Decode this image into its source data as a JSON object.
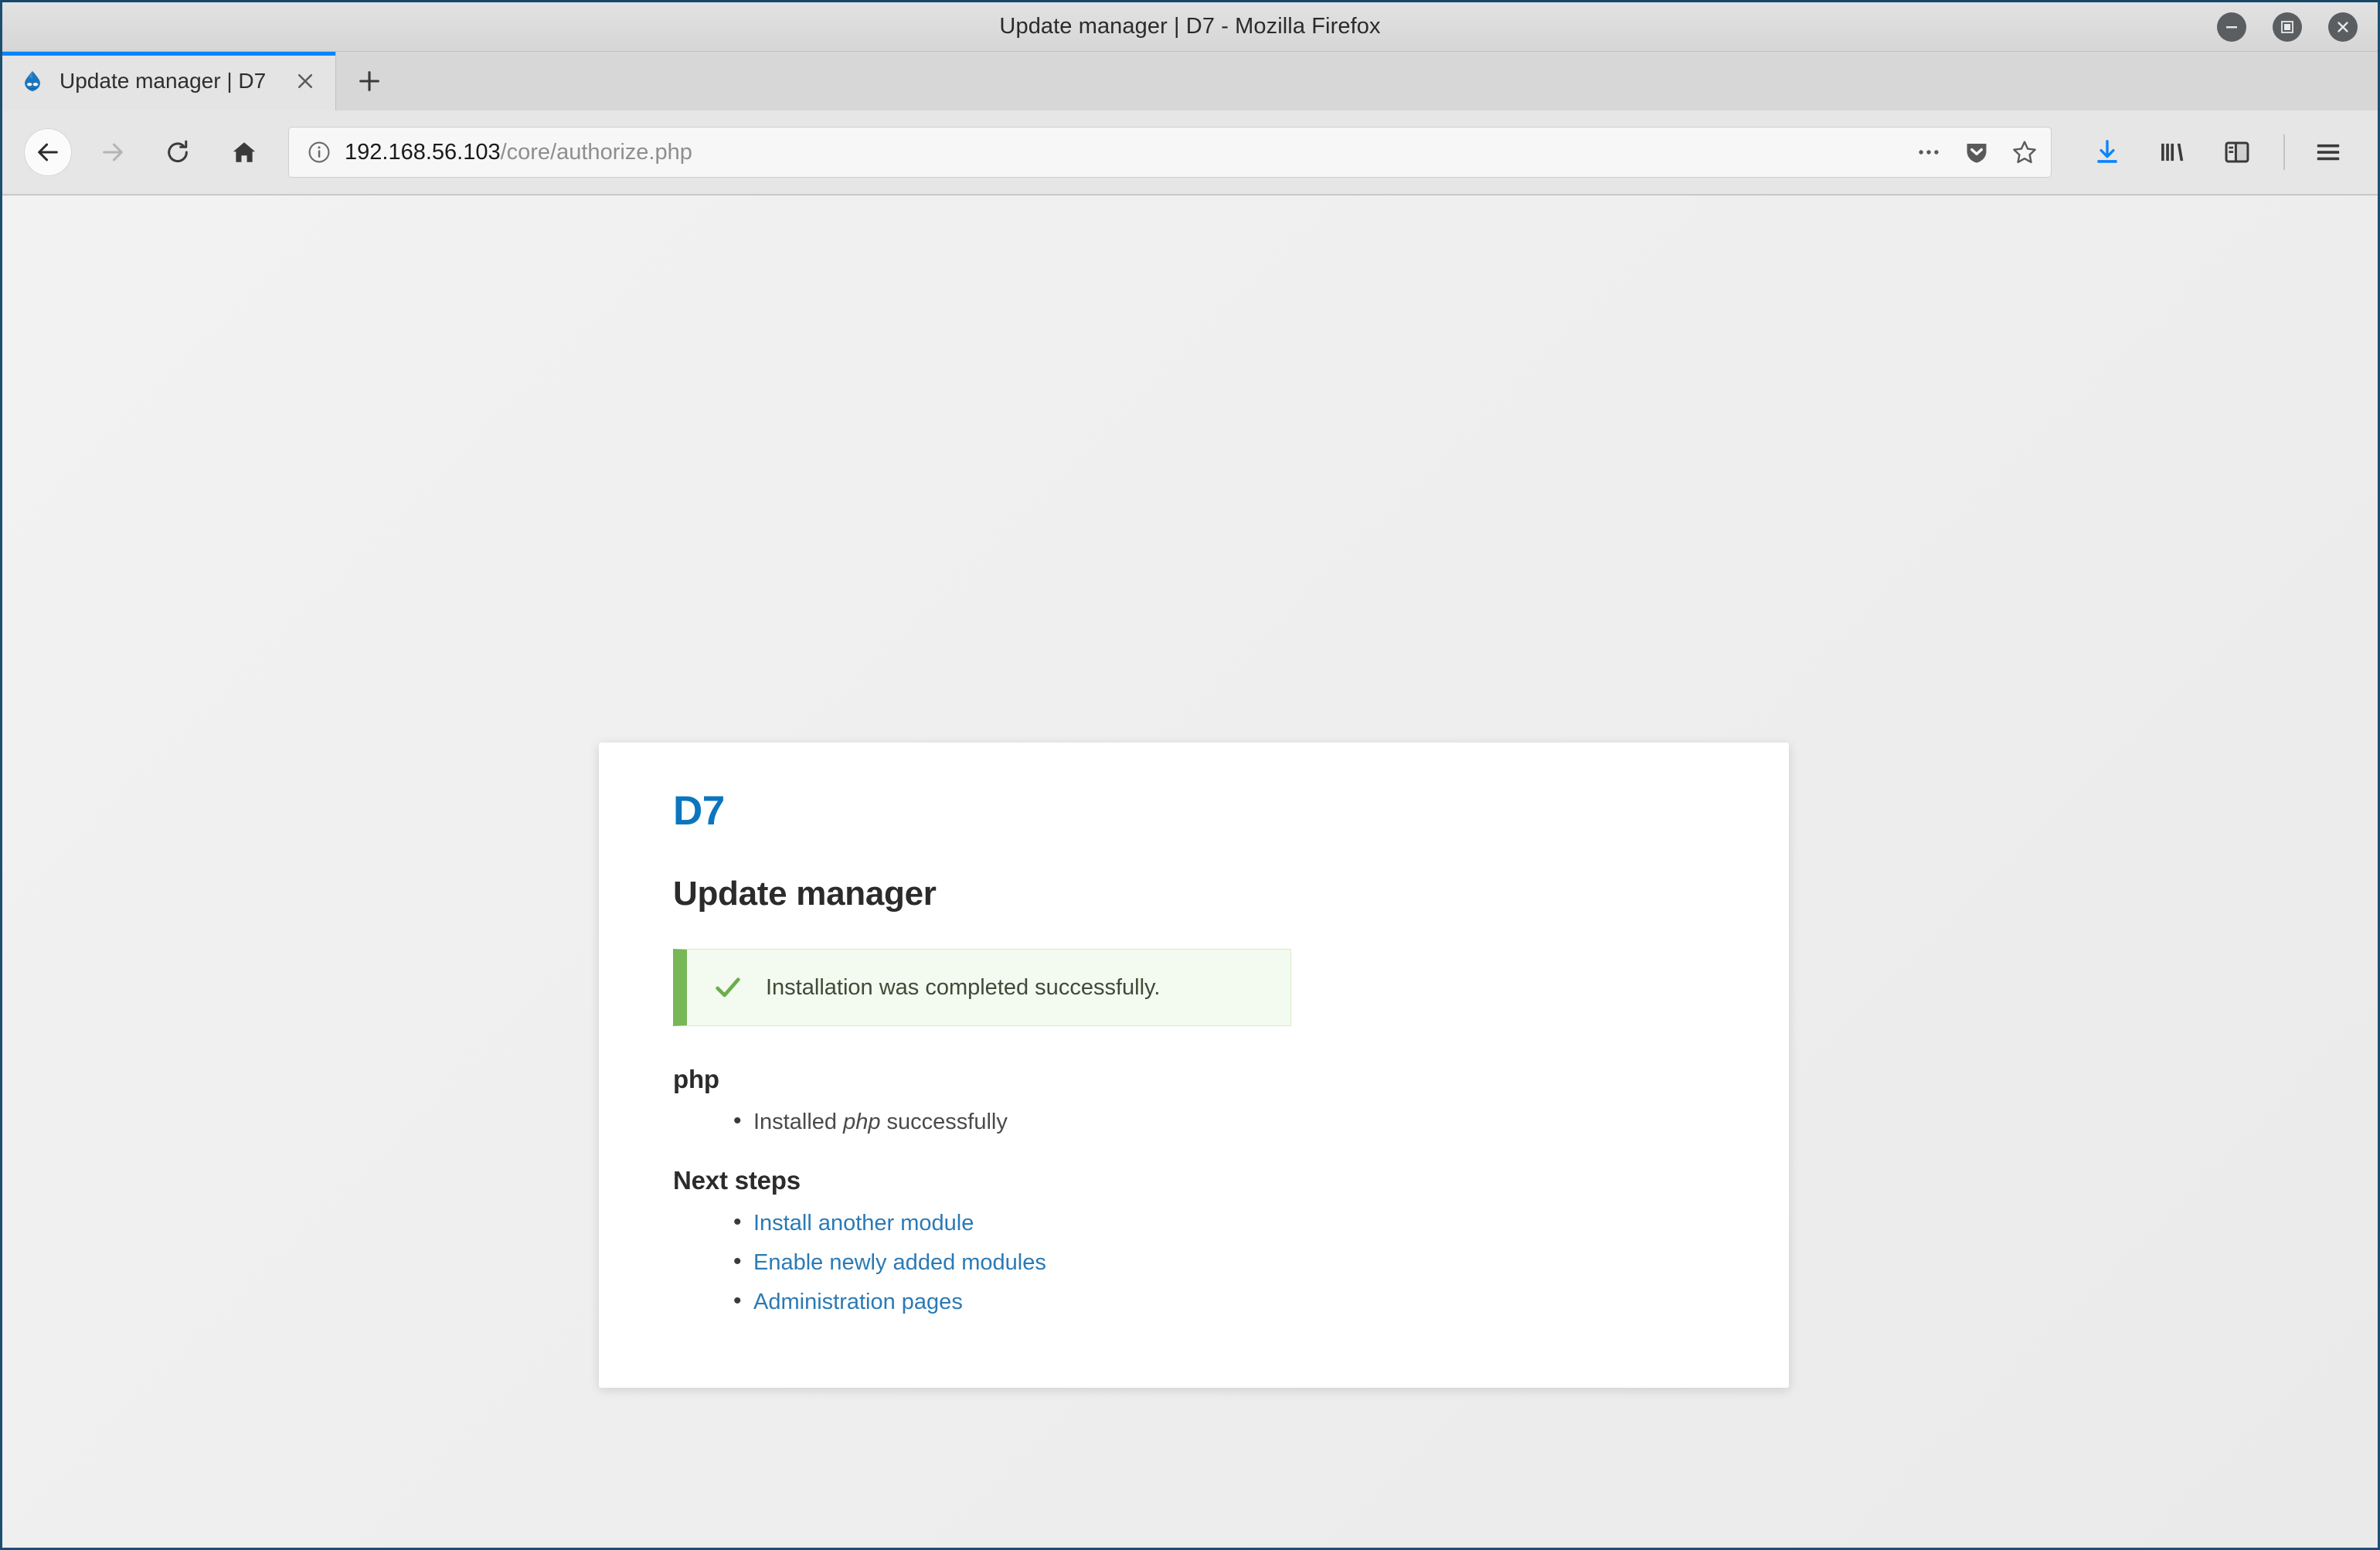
{
  "window": {
    "title": "Update manager | D7 - Mozilla Firefox",
    "controls": {
      "minimize": "minimize",
      "maximize": "maximize",
      "close": "close"
    }
  },
  "tabs": [
    {
      "title": "Update manager | D7",
      "favicon": "drupal-droplet-icon",
      "close_label": "×",
      "active": true
    }
  ],
  "newtab_label": "+",
  "navigation": {
    "back": "back-arrow-icon",
    "forward": "forward-arrow-icon",
    "reload": "reload-icon",
    "home": "home-icon"
  },
  "urlbar": {
    "identity_icon": "info-circle-icon",
    "host": "192.168.56.103",
    "path": "/core/authorize.php",
    "full_url": "192.168.56.103/core/authorize.php",
    "page_actions_label": "…",
    "pocket_icon": "pocket-shield-icon",
    "bookmark_icon": "star-icon"
  },
  "toolbar_right": {
    "downloads": "download-arrow-icon",
    "library": "library-books-icon",
    "sidebar": "sidebar-toggle-icon",
    "menu": "hamburger-menu-icon"
  },
  "page": {
    "brand": "D7",
    "title": "Update manager",
    "status": {
      "icon": "check-icon",
      "message": "Installation was completed successfully."
    },
    "module_section": {
      "heading": "php",
      "items": [
        {
          "prefix": "Installed ",
          "emphasis": "php",
          "suffix": " successfully"
        }
      ]
    },
    "next_steps": {
      "heading": "Next steps",
      "links": [
        "Install another module",
        "Enable newly added modules",
        "Administration pages"
      ]
    }
  },
  "colors": {
    "brand_blue": "#0b76bd",
    "link_blue": "#2a7ab5",
    "success_border": "#77b757",
    "success_bg": "#f3faef",
    "tab_accent": "#0a84ff",
    "download_blue": "#0a84ff"
  }
}
